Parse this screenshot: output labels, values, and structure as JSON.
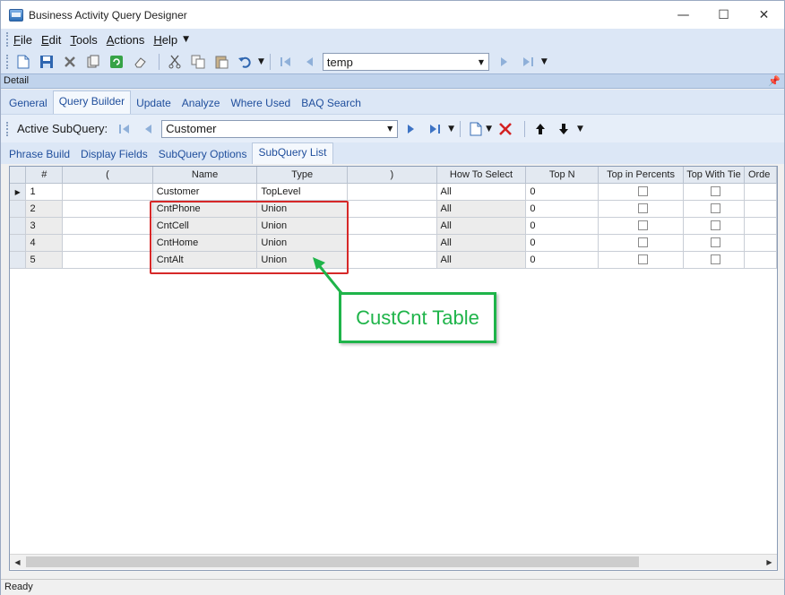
{
  "window": {
    "title": "Business Activity Query Designer"
  },
  "menubar": {
    "items": [
      {
        "label": "File",
        "mnemonic": "F"
      },
      {
        "label": "Edit",
        "mnemonic": "E"
      },
      {
        "label": "Tools",
        "mnemonic": "T"
      },
      {
        "label": "Actions",
        "mnemonic": "A"
      },
      {
        "label": "Help",
        "mnemonic": "H"
      }
    ]
  },
  "toolbar": {
    "query_combo_value": "temp"
  },
  "detail": {
    "label": "Detail"
  },
  "main_tabs": [
    "General",
    "Query Builder",
    "Update",
    "Analyze",
    "Where Used",
    "BAQ Search"
  ],
  "main_tabs_active": "Query Builder",
  "subquery": {
    "label": "Active SubQuery:",
    "value": "Customer"
  },
  "sub_tabs": [
    "Phrase Build",
    "Display Fields",
    "SubQuery Options",
    "SubQuery List"
  ],
  "sub_tabs_active": "SubQuery List",
  "grid": {
    "columns": [
      "#",
      "(",
      "Name",
      "Type",
      ")",
      "How To Select",
      "Top N",
      "Top in Percents",
      "Top With Tie",
      "Orde"
    ],
    "rows": [
      {
        "num": "1",
        "open": "",
        "name": "Customer",
        "type": "TopLevel",
        "close": "",
        "how": "All",
        "topn": "0",
        "pct": false,
        "tie": false
      },
      {
        "num": "2",
        "open": "",
        "name": "CntPhone",
        "type": "Union",
        "close": "",
        "how": "All",
        "topn": "0",
        "pct": false,
        "tie": false
      },
      {
        "num": "3",
        "open": "",
        "name": "CntCell",
        "type": "Union",
        "close": "",
        "how": "All",
        "topn": "0",
        "pct": false,
        "tie": false
      },
      {
        "num": "4",
        "open": "",
        "name": "CntHome",
        "type": "Union",
        "close": "",
        "how": "All",
        "topn": "0",
        "pct": false,
        "tie": false
      },
      {
        "num": "5",
        "open": "",
        "name": "CntAlt",
        "type": "Union",
        "close": "",
        "how": "All",
        "topn": "0",
        "pct": false,
        "tie": false
      }
    ]
  },
  "annotation": {
    "callout_text": "CustCnt Table",
    "box_color": "#d62828",
    "callout_color": "#1fb44a"
  },
  "status": {
    "text": "Ready"
  }
}
